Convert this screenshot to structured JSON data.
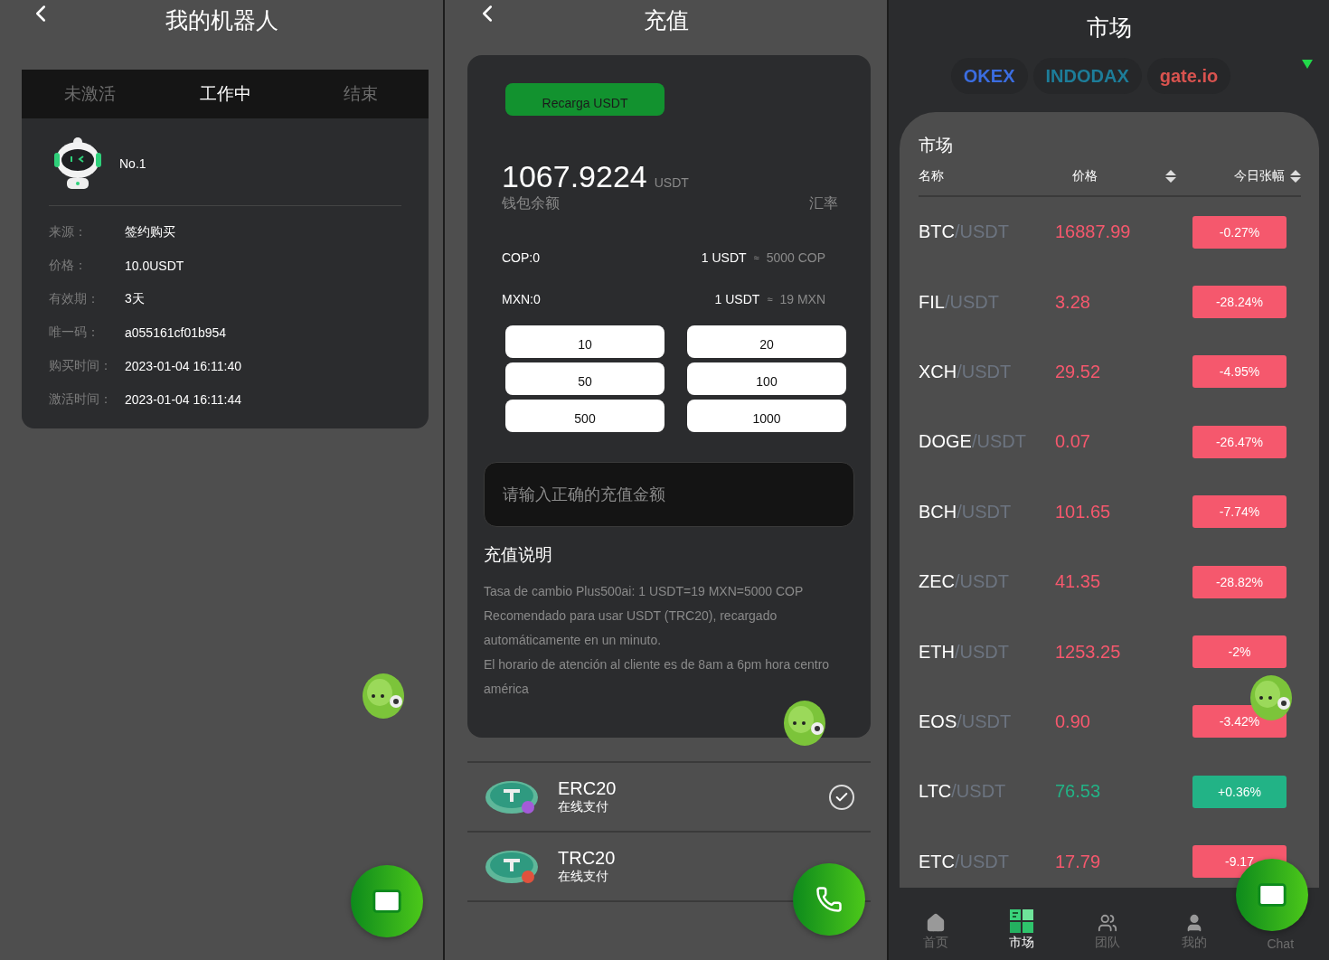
{
  "robots_screen": {
    "title": "我的机器人",
    "tabs": [
      {
        "label": "未激活",
        "selected": false
      },
      {
        "label": "工作中",
        "selected": true
      },
      {
        "label": "结束",
        "selected": false
      }
    ],
    "robot": {
      "name": "No.1",
      "fields": [
        {
          "label": "来源：",
          "value": "签约购买"
        },
        {
          "label": "价格：",
          "value": "10.0USDT"
        },
        {
          "label": "有效期：",
          "value": "3天"
        },
        {
          "label": "唯一码：",
          "value": "a055161cf01b954"
        },
        {
          "label": "购买时间：",
          "value": "2023-01-04 16:11:40"
        },
        {
          "label": "激活时间：",
          "value": "2023-01-04 16:11:44"
        }
      ]
    }
  },
  "recharge_screen": {
    "title": "充值",
    "method_button": "Recarga USDT",
    "balance": "1067.9224",
    "balance_unit": "USDT",
    "balance_label": "钱包余额",
    "rate_label": "汇率",
    "currencies": [
      {
        "balance": "COP:0",
        "rate_base": "1 USDT",
        "rate_sign": "≈",
        "rate_value": "5000 COP"
      },
      {
        "balance": "MXN:0",
        "rate_base": "1 USDT",
        "rate_sign": "≈",
        "rate_value": "19 MXN"
      }
    ],
    "amounts": [
      "10",
      "20",
      "50",
      "100",
      "500",
      "1000"
    ],
    "amount_input": {
      "placeholder": "请输入正确的充值金额"
    },
    "notes_title": "充值说明",
    "notes": [
      "Tasa de cambio Plus500ai: 1 USDT=19 MXN=5000 COP",
      "Recomendado para usar USDT (TRC20), recargado automáticamente en un minuto.",
      "El horario de atención al cliente es de 8am a 6pm hora centro américa"
    ],
    "payment_methods": [
      {
        "name": "ERC20",
        "subtitle": "在线支付",
        "selected": true,
        "color": "#a35bd8"
      },
      {
        "name": "TRC20",
        "subtitle": "在线支付",
        "selected": false,
        "color": "#e0523d"
      }
    ]
  },
  "market_screen": {
    "title": "市场",
    "exchanges": [
      "OKEX",
      "INDODAX",
      "gate.io"
    ],
    "list_title": "市场",
    "columns": [
      "名称",
      "价格",
      "今日张幅"
    ],
    "rows": [
      {
        "base": "BTC",
        "quote": "/USDT",
        "price": "16887.99",
        "change": "-0.27%",
        "color": "#f5586d"
      },
      {
        "base": "FIL",
        "quote": "/USDT",
        "price": "3.28",
        "change": "-28.24%",
        "color": "#f5586d"
      },
      {
        "base": "XCH",
        "quote": "/USDT",
        "price": "29.52",
        "change": "-4.95%",
        "color": "#f5586d"
      },
      {
        "base": "DOGE",
        "quote": "/USDT",
        "price": "0.07",
        "change": "-26.47%",
        "color": "#f5586d"
      },
      {
        "base": "BCH",
        "quote": "/USDT",
        "price": "101.65",
        "change": "-7.74%",
        "color": "#f5586d"
      },
      {
        "base": "ZEC",
        "quote": "/USDT",
        "price": "41.35",
        "change": "-28.82%",
        "color": "#f5586d"
      },
      {
        "base": "ETH",
        "quote": "/USDT",
        "price": "1253.25",
        "change": "-2%",
        "color": "#f5586d"
      },
      {
        "base": "EOS",
        "quote": "/USDT",
        "price": "0.90",
        "change": "-3.42%",
        "color": "#f5586d"
      },
      {
        "base": "LTC",
        "quote": "/USDT",
        "price": "76.53",
        "change": "+0.36%",
        "color": "#22b386"
      },
      {
        "base": "ETC",
        "quote": "/USDT",
        "price": "17.79",
        "change": "-9.17",
        "color": "#f5586d"
      }
    ],
    "nav": [
      {
        "label": "首页",
        "selected": false
      },
      {
        "label": "市场",
        "selected": true
      },
      {
        "label": "团队",
        "selected": false
      },
      {
        "label": "我的",
        "selected": false
      },
      {
        "label": "Chat",
        "selected": false
      }
    ]
  }
}
